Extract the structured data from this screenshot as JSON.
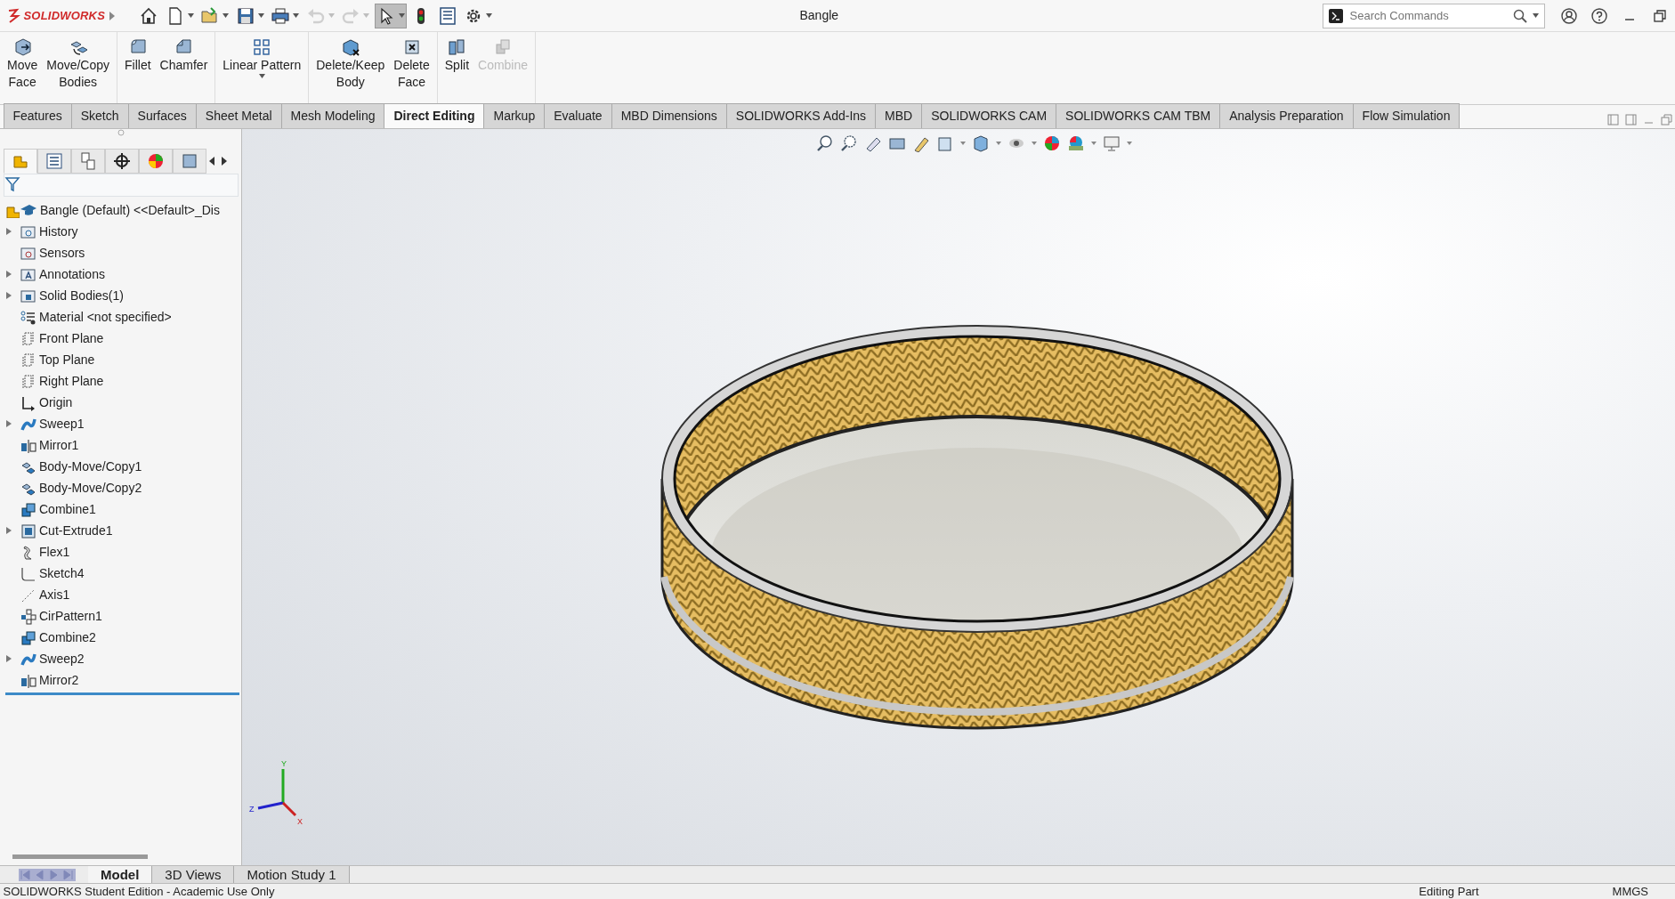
{
  "app": {
    "logo_text": "SOLIDWORKS"
  },
  "quick_access": [
    {
      "kind": "home",
      "disabled": false,
      "pressed": false,
      "dropdown": false
    },
    {
      "kind": "new",
      "disabled": false,
      "pressed": false,
      "dropdown": true
    },
    {
      "kind": "open",
      "disabled": false,
      "pressed": false,
      "dropdown": true
    },
    {
      "kind": "save",
      "disabled": false,
      "pressed": false,
      "dropdown": true
    },
    {
      "kind": "print",
      "disabled": false,
      "pressed": false,
      "dropdown": true
    },
    {
      "kind": "undo",
      "disabled": true,
      "pressed": false,
      "dropdown": true
    },
    {
      "kind": "redo",
      "disabled": true,
      "pressed": false,
      "dropdown": true
    },
    {
      "kind": "select",
      "disabled": false,
      "pressed": true,
      "dropdown": true
    },
    {
      "kind": "light",
      "disabled": false,
      "pressed": false,
      "dropdown": false
    },
    {
      "kind": "list",
      "disabled": false,
      "pressed": false,
      "dropdown": false
    },
    {
      "kind": "gear",
      "disabled": false,
      "pressed": false,
      "dropdown": true
    }
  ],
  "window": {
    "title": "Bangle"
  },
  "search": {
    "placeholder": "Search Commands"
  },
  "ribbon_groups": [
    [
      {
        "label": "Move\nFace",
        "kind": "moveface",
        "disabled": false,
        "dropdown": false
      },
      {
        "label": "Move/Copy\nBodies",
        "kind": "movecopy",
        "disabled": false,
        "dropdown": false
      }
    ],
    [
      {
        "label": "Fillet",
        "kind": "fillet",
        "disabled": false,
        "dropdown": false
      },
      {
        "label": "Chamfer",
        "kind": "chamfer",
        "disabled": false,
        "dropdown": false
      }
    ],
    [
      {
        "label": "Linear Pattern",
        "kind": "pattern",
        "disabled": false,
        "dropdown": true
      }
    ],
    [
      {
        "label": "Delete/Keep\nBody",
        "kind": "deletebody",
        "disabled": false,
        "dropdown": false
      },
      {
        "label": "Delete\nFace",
        "kind": "deleteface",
        "disabled": false,
        "dropdown": false
      }
    ],
    [
      {
        "label": "Split",
        "kind": "split",
        "disabled": false,
        "dropdown": false
      },
      {
        "label": "Combine",
        "kind": "combine",
        "disabled": true,
        "dropdown": false
      }
    ]
  ],
  "tabs": [
    {
      "label": "Features",
      "selected": false
    },
    {
      "label": "Sketch",
      "selected": false
    },
    {
      "label": "Surfaces",
      "selected": false
    },
    {
      "label": "Sheet Metal",
      "selected": false
    },
    {
      "label": "Mesh Modeling",
      "selected": false
    },
    {
      "label": "Direct Editing",
      "selected": true
    },
    {
      "label": "Markup",
      "selected": false
    },
    {
      "label": "Evaluate",
      "selected": false
    },
    {
      "label": "MBD Dimensions",
      "selected": false
    },
    {
      "label": "SOLIDWORKS Add-Ins",
      "selected": false
    },
    {
      "label": "MBD",
      "selected": false
    },
    {
      "label": "SOLIDWORKS CAM",
      "selected": false
    },
    {
      "label": "SOLIDWORKS CAM TBM",
      "selected": false
    },
    {
      "label": "Analysis Preparation",
      "selected": false
    },
    {
      "label": "Flow Simulation",
      "selected": false
    }
  ],
  "panel_tabs": [
    {
      "kind": "tree",
      "selected": true
    },
    {
      "kind": "props",
      "selected": false
    },
    {
      "kind": "config",
      "selected": false
    },
    {
      "kind": "dim",
      "selected": false
    },
    {
      "kind": "display",
      "selected": false
    },
    {
      "kind": "cam",
      "selected": false
    }
  ],
  "tree": {
    "root": {
      "label": "Bangle (Default) <<Default>_Dis"
    },
    "items": [
      {
        "label": "History",
        "kind": "history",
        "expandable": true
      },
      {
        "label": "Sensors",
        "kind": "sensors",
        "expandable": false
      },
      {
        "label": "Annotations",
        "kind": "annotations",
        "expandable": true
      },
      {
        "label": "Solid Bodies(1)",
        "kind": "bodies",
        "expandable": true
      },
      {
        "label": "Material <not specified>",
        "kind": "material",
        "expandable": false
      },
      {
        "label": "Front Plane",
        "kind": "plane",
        "expandable": false
      },
      {
        "label": "Top Plane",
        "kind": "plane",
        "expandable": false
      },
      {
        "label": "Right Plane",
        "kind": "plane",
        "expandable": false
      },
      {
        "label": "Origin",
        "kind": "origin",
        "expandable": false
      },
      {
        "label": "Sweep1",
        "kind": "sweep",
        "expandable": true
      },
      {
        "label": "Mirror1",
        "kind": "mirror",
        "expandable": false
      },
      {
        "label": "Body-Move/Copy1",
        "kind": "move",
        "expandable": false
      },
      {
        "label": "Body-Move/Copy2",
        "kind": "move",
        "expandable": false
      },
      {
        "label": "Combine1",
        "kind": "combine",
        "expandable": false
      },
      {
        "label": "Cut-Extrude1",
        "kind": "cut",
        "expandable": true
      },
      {
        "label": "Flex1",
        "kind": "flex",
        "expandable": false
      },
      {
        "label": "Sketch4",
        "kind": "sketch",
        "expandable": false
      },
      {
        "label": "Axis1",
        "kind": "axis",
        "expandable": false
      },
      {
        "label": "CirPattern1",
        "kind": "cirpattern",
        "expandable": false
      },
      {
        "label": "Combine2",
        "kind": "combine",
        "expandable": false
      },
      {
        "label": "Sweep2",
        "kind": "sweep",
        "expandable": true
      },
      {
        "label": "Mirror2",
        "kind": "mirror",
        "expandable": false
      }
    ]
  },
  "triad": {
    "y": "Y",
    "z": "Z",
    "x": "X"
  },
  "bottom_tabs": [
    {
      "label": "Model",
      "selected": true
    },
    {
      "label": "3D Views",
      "selected": false
    },
    {
      "label": "Motion Study 1",
      "selected": false
    }
  ],
  "status_bar": {
    "left": "SOLIDWORKS Student Edition - Academic Use Only",
    "state": "Editing Part",
    "units": "MMGS"
  }
}
